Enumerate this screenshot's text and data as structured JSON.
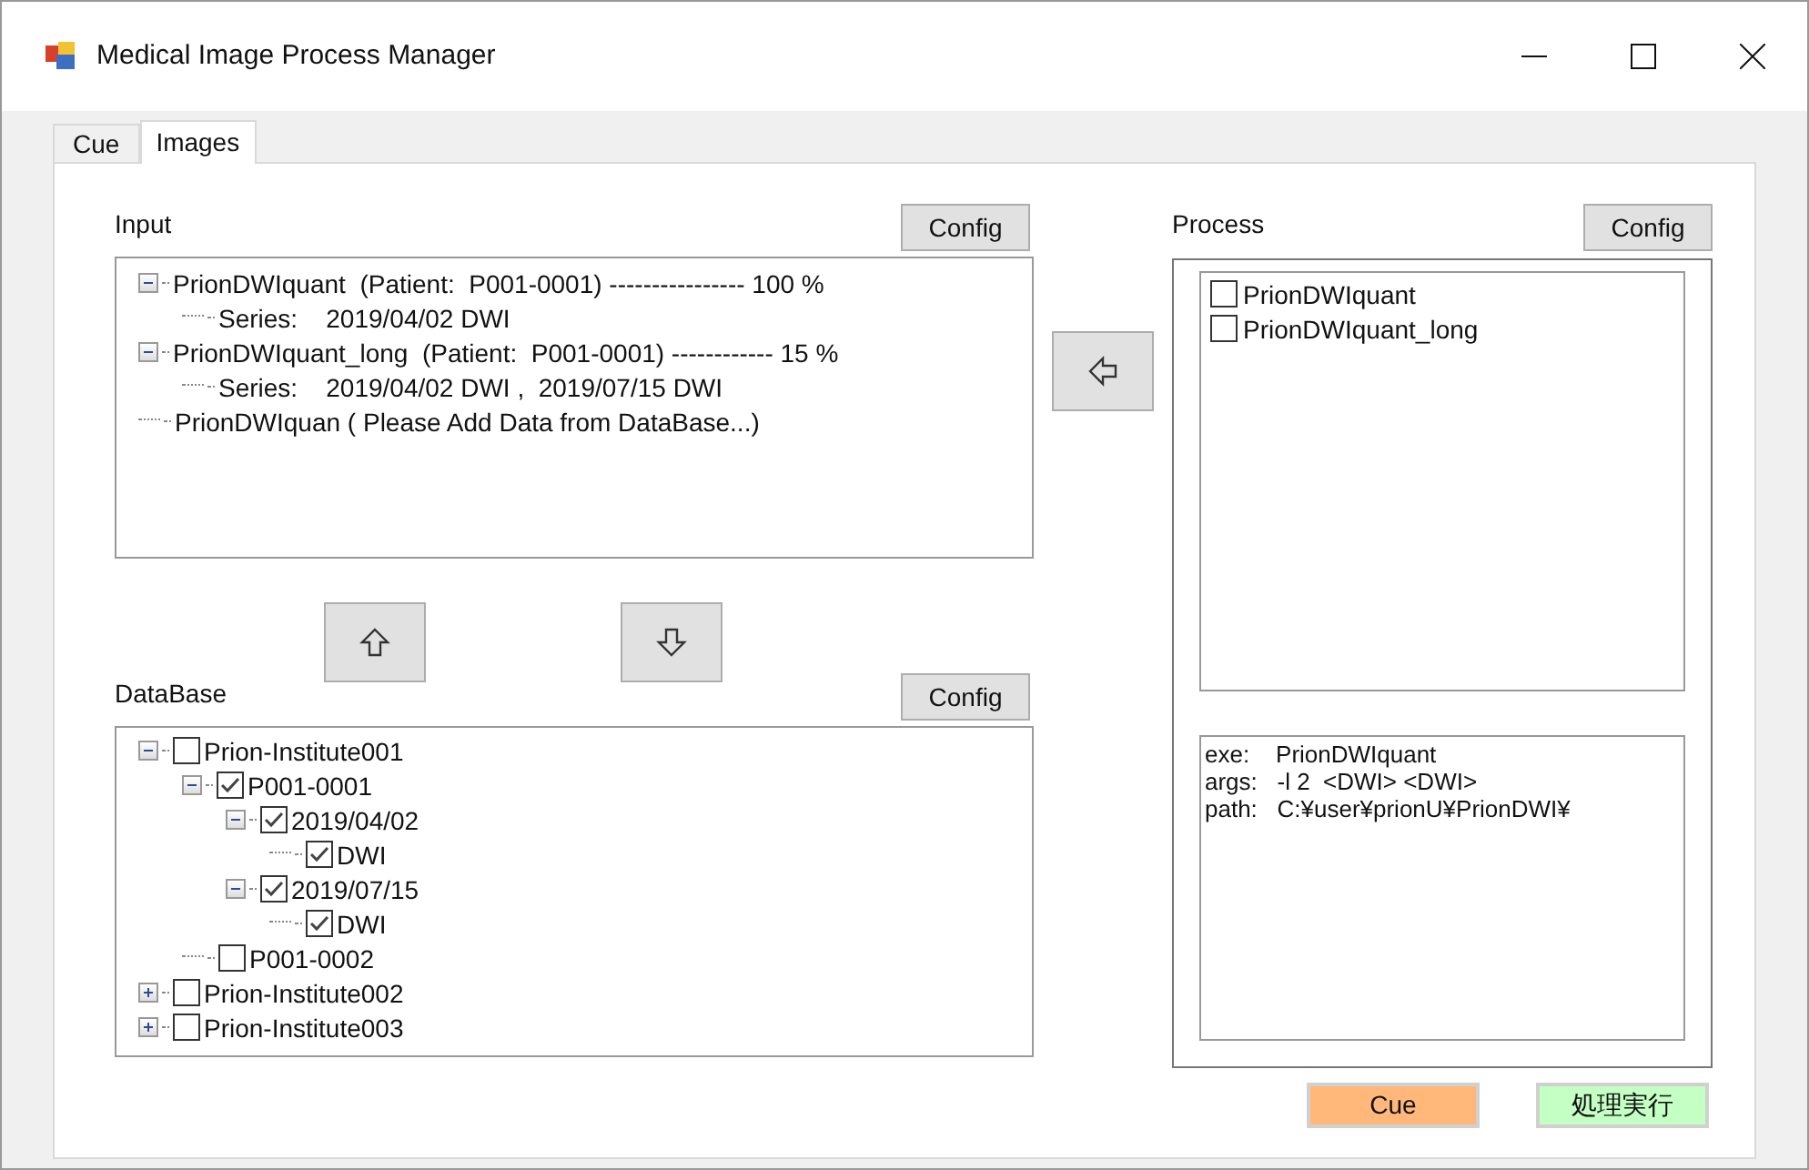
{
  "window": {
    "title": "Medical Image Process Manager"
  },
  "tabs": [
    {
      "label": "Cue",
      "selected": false
    },
    {
      "label": "Images",
      "selected": true
    }
  ],
  "input": {
    "label": "Input",
    "config": "Config",
    "items": [
      {
        "text": "PrionDWIquant  (Patient:  P001-0001) ---------------- 100 %",
        "expanded": true,
        "children": [
          {
            "text": "Series:    2019/04/02 DWI"
          }
        ]
      },
      {
        "text": "PrionDWIquant_long  (Patient:  P001-0001) ------------ 15 %",
        "expanded": true,
        "children": [
          {
            "text": "Series:    2019/04/02 DWI ,  2019/07/15 DWI"
          }
        ]
      },
      {
        "text": "PrionDWIquan ( Please Add Data from DataBase...)"
      }
    ]
  },
  "database": {
    "label": "DataBase",
    "config": "Config",
    "items": [
      {
        "text": "Prion-Institute001",
        "checked": false,
        "expanded": true,
        "children": [
          {
            "text": "P001-0001",
            "checked": true,
            "expanded": true,
            "children": [
              {
                "text": "2019/04/02",
                "checked": true,
                "expanded": true,
                "children": [
                  {
                    "text": "DWI",
                    "checked": true
                  }
                ]
              },
              {
                "text": "2019/07/15",
                "checked": true,
                "expanded": true,
                "children": [
                  {
                    "text": "DWI",
                    "checked": true
                  }
                ]
              }
            ]
          },
          {
            "text": "P001-0002",
            "checked": false
          }
        ]
      },
      {
        "text": "Prion-Institute002",
        "checked": false,
        "expanded": false
      },
      {
        "text": "Prion-Institute003",
        "checked": false,
        "expanded": false
      }
    ]
  },
  "process": {
    "label": "Process",
    "config": "Config",
    "items": [
      {
        "text": "PrionDWIquant",
        "checked": false
      },
      {
        "text": "PrionDWIquant_long",
        "checked": false
      }
    ],
    "info": [
      "exe:    PrionDWIquant",
      "args:   -l 2  <DWI> <DWI>",
      "path:   C:¥user¥prionU¥PrionDWI¥"
    ]
  },
  "buttons": [
    {
      "label": "Cue",
      "kind": "cue"
    },
    {
      "label": "処理実行",
      "kind": "run"
    }
  ]
}
